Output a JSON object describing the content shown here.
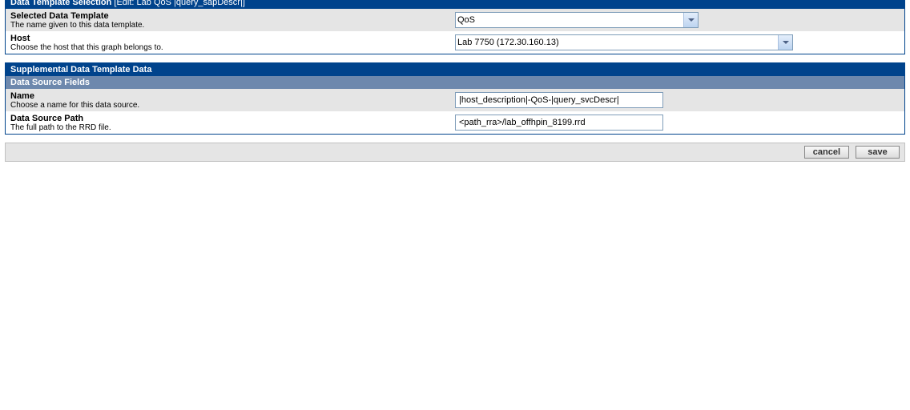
{
  "section1": {
    "header": "Data Template Selection",
    "header_sub": "[Edit: Lab       QoS |query_sapDescr|]",
    "template": {
      "label": "Selected Data Template",
      "desc": "The name given to this data template.",
      "value": "QoS"
    },
    "host": {
      "label": "Host",
      "desc": "Choose the host that this graph belongs to.",
      "value": "Lab 7750 (172.30.160.13)"
    }
  },
  "section2": {
    "header": "Supplemental Data Template Data",
    "subheader": "Data Source Fields",
    "name": {
      "label": "Name",
      "desc": "Choose a name for this data source.",
      "value": "|host_description|-QoS-|query_svcDescr|"
    },
    "path": {
      "label": "Data Source Path",
      "desc": "The full path to the RRD file.",
      "value": "<path_rra>/lab_offhpin_8199.rrd"
    }
  },
  "footer": {
    "cancel": "cancel",
    "save": "save"
  }
}
